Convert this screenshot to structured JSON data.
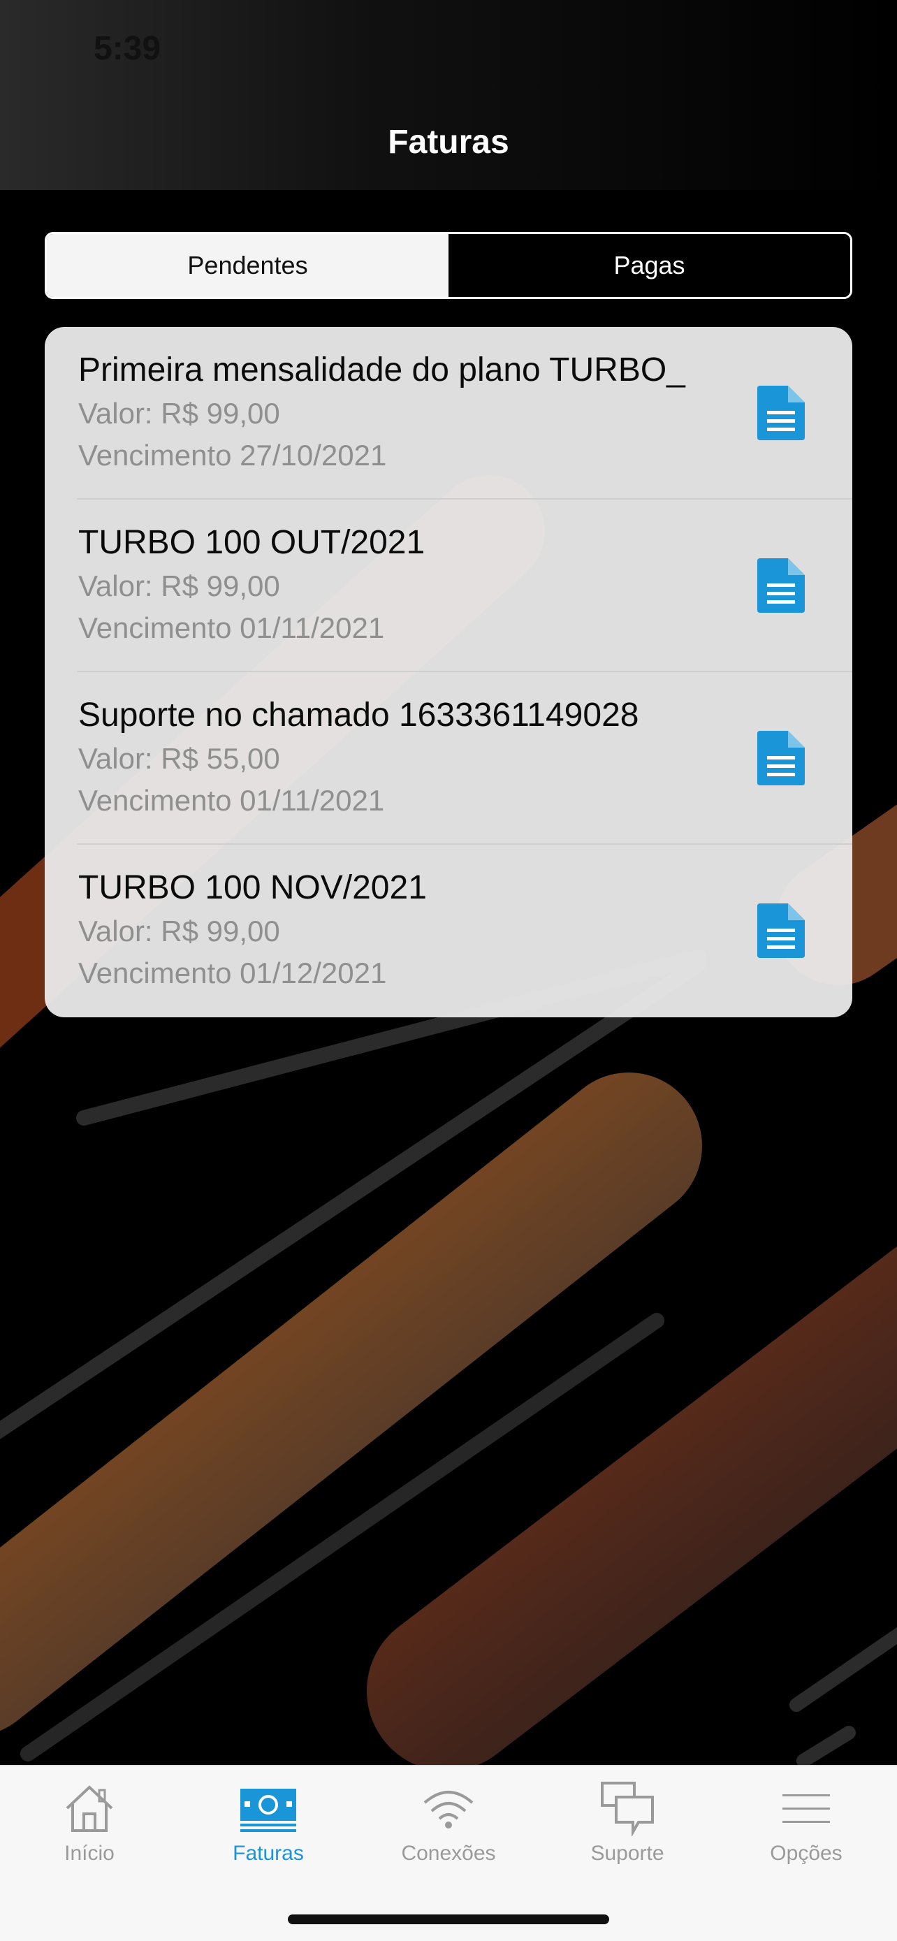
{
  "status_bar": {
    "time": "5:39"
  },
  "header": {
    "title": "Faturas"
  },
  "segments": [
    {
      "label": "Pendentes",
      "active": true
    },
    {
      "label": "Pagas",
      "active": false
    }
  ],
  "invoices": [
    {
      "title": "Primeira mensalidade do plano TURBO_",
      "value": "Valor: R$ 99,00",
      "due": "Vencimento 27/10/2021",
      "icon": "document-icon"
    },
    {
      "title": "TURBO 100 OUT/2021",
      "value": "Valor: R$ 99,00",
      "due": "Vencimento 01/11/2021",
      "icon": "document-icon"
    },
    {
      "title": "Suporte no chamado 1633361149028",
      "value": "Valor: R$ 55,00",
      "due": "Vencimento 01/11/2021",
      "icon": "document-icon"
    },
    {
      "title": "TURBO 100 NOV/2021",
      "value": "Valor: R$ 99,00",
      "due": "Vencimento 01/12/2021",
      "icon": "document-icon"
    }
  ],
  "tabbar": {
    "items": [
      {
        "label": "Início",
        "icon": "home-icon",
        "active": false
      },
      {
        "label": "Faturas",
        "icon": "banknote-icon",
        "active": true
      },
      {
        "label": "Conexões",
        "icon": "wifi-icon",
        "active": false
      },
      {
        "label": "Suporte",
        "icon": "chat-bubbles-icon",
        "active": false
      },
      {
        "label": "Opções",
        "icon": "menu-icon",
        "active": false
      }
    ]
  },
  "colors": {
    "accent": "#1a96d8",
    "doc_icon": "#1a96d8",
    "orange": "#b8561f"
  }
}
